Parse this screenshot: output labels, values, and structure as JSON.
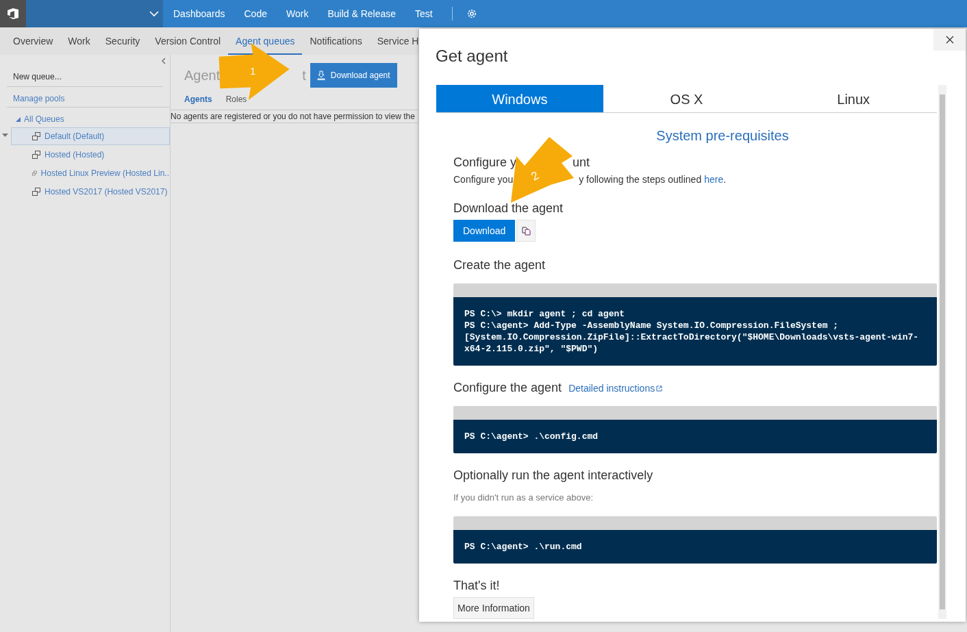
{
  "top_nav": {
    "items": [
      "Dashboards",
      "Code",
      "Work",
      "Build & Release",
      "Test"
    ]
  },
  "sub_nav": {
    "tabs": [
      {
        "label": "Overview",
        "selected": false
      },
      {
        "label": "Work",
        "selected": false
      },
      {
        "label": "Security",
        "selected": false
      },
      {
        "label": "Version Control",
        "selected": false
      },
      {
        "label": "Agent queues",
        "selected": true
      },
      {
        "label": "Notifications",
        "selected": false
      },
      {
        "label": "Service H",
        "selected": false
      }
    ]
  },
  "sidebar": {
    "actions": [
      "New queue...",
      "Manage pools"
    ],
    "tree": {
      "label": "All Queues",
      "expanded": true,
      "children": [
        {
          "label": "Default (Default)",
          "selected": true
        },
        {
          "label": "Hosted (Hosted)",
          "selected": false
        },
        {
          "label": "Hosted Linux Preview (Hosted Lin..",
          "selected": false
        },
        {
          "label": "Hosted VS2017 (Hosted VS2017)",
          "selected": false
        }
      ]
    }
  },
  "main": {
    "title_parts": [
      "Agent",
      "t"
    ],
    "button": "Download agent",
    "tabs": [
      {
        "label": "Agents",
        "selected": true
      },
      {
        "label": "Roles",
        "selected": false
      }
    ],
    "message": "No agents are registered or you do not have permission to view the"
  },
  "dialog": {
    "title": "Get agent",
    "tabs": [
      {
        "label": "Windows",
        "selected": true
      },
      {
        "label": "OS X",
        "selected": false
      },
      {
        "label": "Linux",
        "selected": false
      }
    ],
    "prereq_link": "System pre-requisites",
    "sections": [
      {
        "kind": "heading",
        "parts": [
          "Configure y",
          "unt"
        ]
      },
      {
        "kind": "paragraph",
        "parts": [
          "Configure you",
          "y following the steps outlined"
        ],
        "link": "here",
        "end": "."
      },
      {
        "kind": "download",
        "title": "Download the agent",
        "button": "Download"
      },
      {
        "kind": "heading",
        "parts": [
          "Create the agent"
        ]
      },
      {
        "kind": "code",
        "lines": [
          "PS C:\\> mkdir agent ; cd agent",
          "PS C:\\agent> Add-Type -AssemblyName System.IO.Compression.FileSystem ;",
          "[System.IO.Compression.ZipFile]::ExtractToDirectory(\"$HOME\\Downloads\\vsts-agent-win7-",
          "x64-2.115.0.zip\", \"$PWD\")"
        ]
      },
      {
        "kind": "heading",
        "parts": [
          "Configure the agent"
        ],
        "link": "Detailed instructions"
      },
      {
        "kind": "code",
        "lines": [
          "PS C:\\agent> .\\config.cmd"
        ]
      },
      {
        "kind": "heading",
        "parts": [
          "Optionally run the agent interactively"
        ]
      },
      {
        "kind": "note",
        "text": "If you didn't run as a service above:"
      },
      {
        "kind": "code",
        "lines": [
          "PS C:\\agent> .\\run.cmd"
        ]
      },
      {
        "kind": "heading",
        "parts": [
          "That's it!"
        ]
      },
      {
        "kind": "button",
        "text": "More Information"
      }
    ]
  },
  "callouts": [
    {
      "label": "1"
    },
    {
      "label": "2"
    }
  ]
}
